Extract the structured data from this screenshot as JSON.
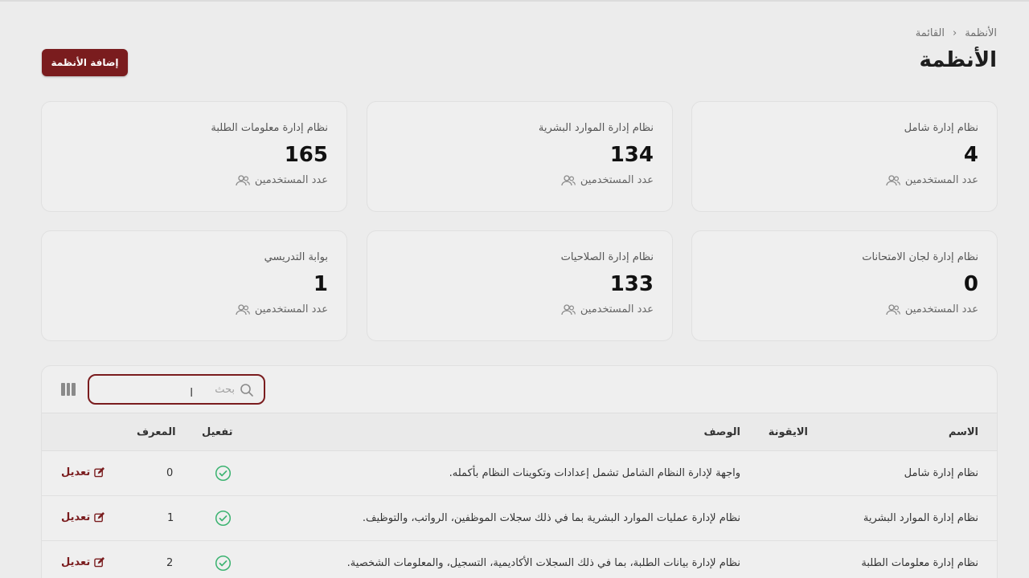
{
  "breadcrumb": {
    "items": [
      "الأنظمة",
      "القائمة"
    ],
    "separator": "›"
  },
  "page": {
    "title": "الأنظمة",
    "add_button": "إضافة الأنظمة"
  },
  "cards": [
    {
      "name": "نظام إدارة شامل",
      "value": "4",
      "sub": "عدد المستخدمين"
    },
    {
      "name": "نظام إدارة الموارد البشرية",
      "value": "134",
      "sub": "عدد المستخدمين"
    },
    {
      "name": "نظام إدارة معلومات الطلبة",
      "value": "165",
      "sub": "عدد المستخدمين"
    },
    {
      "name": "نظام إدارة لجان الامتحانات",
      "value": "0",
      "sub": "عدد المستخدمين"
    },
    {
      "name": "نظام إدارة الصلاحيات",
      "value": "133",
      "sub": "عدد المستخدمين"
    },
    {
      "name": "بوابة التدريسي",
      "value": "1",
      "sub": "عدد المستخدمين"
    }
  ],
  "search": {
    "placeholder": "بحث",
    "value": ""
  },
  "table": {
    "columns": {
      "name": "الاسم",
      "icon": "الايقونة",
      "description": "الوصف",
      "active": "تفعيل",
      "id": "المعرف"
    },
    "rows": [
      {
        "name": "نظام إدارة شامل",
        "description": "واجهة لإدارة النظام الشامل تشمل إعدادات وتكوينات النظام بأكمله.",
        "active": true,
        "id": "0",
        "edit": "تعديل"
      },
      {
        "name": "نظام إدارة الموارد البشرية",
        "description": "نظام لإدارة عمليات الموارد البشرية بما في ذلك سجلات الموظفين، الرواتب، والتوظيف.",
        "active": true,
        "id": "1",
        "edit": "تعديل"
      },
      {
        "name": "نظام إدارة معلومات الطلبة",
        "description": "نظام لإدارة بيانات الطلبة، بما في ذلك السجلات الأكاديمية، التسجيل، والمعلومات الشخصية.",
        "active": true,
        "id": "2",
        "edit": "تعديل"
      }
    ]
  },
  "colors": {
    "accent": "#7a1c1e",
    "success": "#3cb371",
    "background": "#ececec"
  },
  "icons": {
    "search": "search-icon",
    "users": "users-icon",
    "check": "check-circle-icon",
    "edit": "edit-icon",
    "columns": "columns-icon"
  }
}
